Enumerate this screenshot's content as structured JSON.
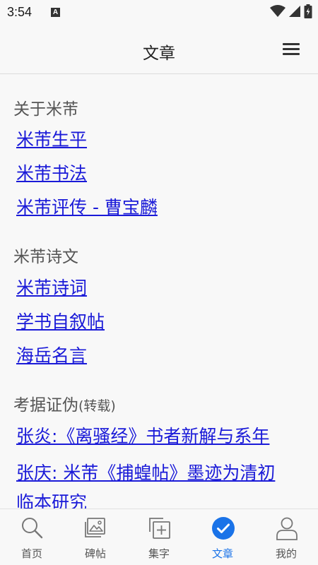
{
  "status": {
    "time": "3:54",
    "notif_letter": "A"
  },
  "header": {
    "title": "文章",
    "menu_icon": "hamburger-menu-icon"
  },
  "sections": [
    {
      "title": "关于米芾",
      "links": [
        "米芾生平",
        "米芾书法",
        "米芾评传 - 曹宝麟"
      ]
    },
    {
      "title": "米芾诗文",
      "links": [
        "米芾诗词",
        "学书自叙帖",
        "海岳名言"
      ]
    },
    {
      "title": "考据证伪",
      "title_sub": "(转载)",
      "links": [
        "张炎:《离骚经》书者新解与系年",
        "张庆: 米芾《捕蝗帖》墨迹为清初",
        "临本研究"
      ]
    }
  ],
  "bottom_nav": [
    {
      "label": "首页",
      "icon": "search-icon"
    },
    {
      "label": "碑帖",
      "icon": "image-icon"
    },
    {
      "label": "集字",
      "icon": "add-copy-icon"
    },
    {
      "label": "文章",
      "icon": "check-circle-icon",
      "active": true
    },
    {
      "label": "我的",
      "icon": "person-icon"
    }
  ],
  "colors": {
    "link": "#1a1ad8",
    "accent": "#1a73e8",
    "text_muted": "#555555",
    "background": "#f8f8f8"
  }
}
